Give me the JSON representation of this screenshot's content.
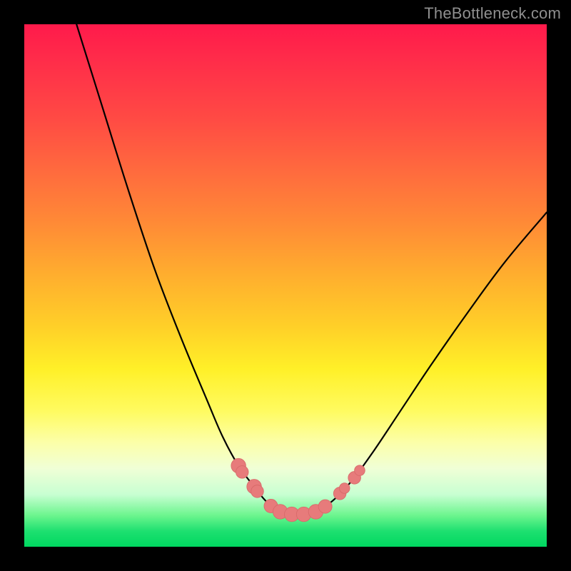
{
  "watermark": {
    "text": "TheBottleneck.com"
  },
  "colors": {
    "curve_stroke": "#000000",
    "marker_fill": "#e77b7b",
    "marker_stroke": "#d86a6a"
  },
  "chart_data": {
    "type": "line",
    "title": "",
    "xlabel": "",
    "ylabel": "",
    "xlim": [
      0,
      100
    ],
    "ylim": [
      0,
      100
    ],
    "note": "No axis ticks or numeric labels are visible; x and y are normalized 0–100. y increases downward as drawn (0 = top of gradient, 100 = bottom green band). Curve descends steeply from upper-left, flattens near the bottom around x≈48–58, then rises toward upper-right.",
    "series": [
      {
        "name": "bottleneck-curve",
        "x": [
          10,
          15,
          20,
          25,
          30,
          35,
          38,
          41,
          44,
          46,
          48,
          50,
          52,
          54,
          56,
          58,
          60,
          63,
          67,
          72,
          78,
          85,
          92,
          100
        ],
        "values": [
          0,
          16,
          32,
          47,
          60,
          72,
          79,
          84.5,
          88.5,
          91,
          92.8,
          93.6,
          93.9,
          93.7,
          93.1,
          92,
          90.3,
          87,
          81.5,
          74,
          65,
          55,
          45.5,
          36
        ]
      }
    ],
    "markers": {
      "name": "highlight-points",
      "note": "Salmon/pink rounded markers clustered near the curve minimum.",
      "points": [
        {
          "x": 41.0,
          "y": 84.5,
          "r": 1.4
        },
        {
          "x": 41.7,
          "y": 85.7,
          "r": 1.2
        },
        {
          "x": 44.0,
          "y": 88.5,
          "r": 1.4
        },
        {
          "x": 44.6,
          "y": 89.4,
          "r": 1.2
        },
        {
          "x": 47.2,
          "y": 92.2,
          "r": 1.3
        },
        {
          "x": 49.0,
          "y": 93.3,
          "r": 1.4
        },
        {
          "x": 51.2,
          "y": 93.8,
          "r": 1.4
        },
        {
          "x": 53.5,
          "y": 93.8,
          "r": 1.4
        },
        {
          "x": 55.8,
          "y": 93.3,
          "r": 1.4
        },
        {
          "x": 57.6,
          "y": 92.3,
          "r": 1.3
        },
        {
          "x": 60.4,
          "y": 89.8,
          "r": 1.2
        },
        {
          "x": 61.3,
          "y": 88.8,
          "r": 1.0
        },
        {
          "x": 63.2,
          "y": 86.8,
          "r": 1.2
        },
        {
          "x": 64.2,
          "y": 85.4,
          "r": 1.0
        }
      ]
    }
  }
}
